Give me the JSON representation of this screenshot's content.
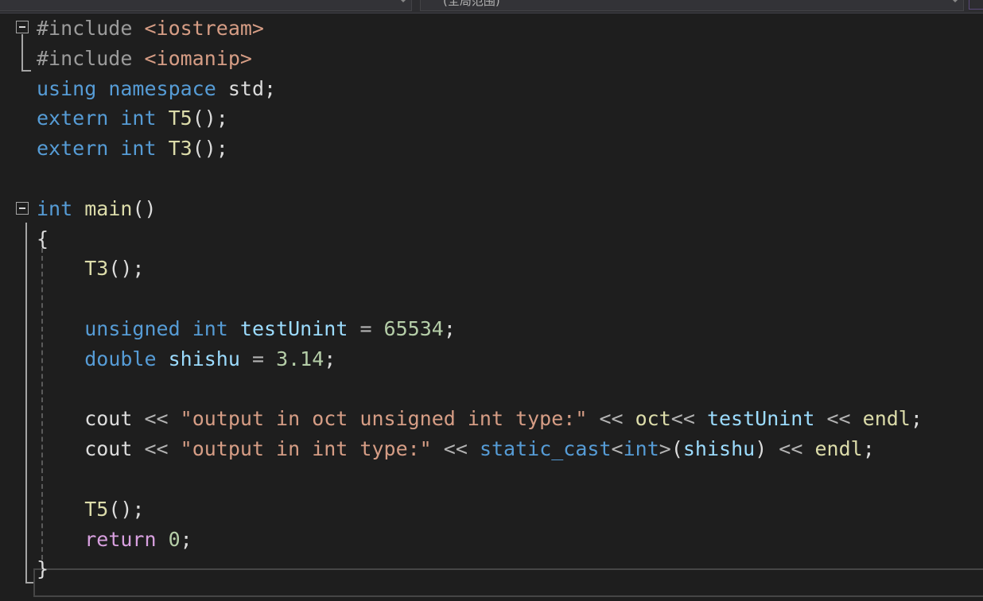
{
  "navbar": {
    "scope_dropdown": "(全局范围)"
  },
  "editor": {
    "lines": [
      {
        "tokens": [
          {
            "c": "inc",
            "t": "#include "
          },
          {
            "c": "hdr",
            "t": "<iostream>"
          }
        ]
      },
      {
        "tokens": [
          {
            "c": "inc",
            "t": "#include "
          },
          {
            "c": "hdr",
            "t": "<iomanip>"
          }
        ]
      },
      {
        "tokens": [
          {
            "c": "kw",
            "t": "using"
          },
          {
            "c": "id",
            "t": " "
          },
          {
            "c": "kw",
            "t": "namespace"
          },
          {
            "c": "id",
            "t": " std;"
          }
        ]
      },
      {
        "tokens": [
          {
            "c": "kw",
            "t": "extern"
          },
          {
            "c": "id",
            "t": " "
          },
          {
            "c": "kw",
            "t": "int"
          },
          {
            "c": "id",
            "t": " "
          },
          {
            "c": "fn",
            "t": "T5"
          },
          {
            "c": "id",
            "t": "();"
          }
        ]
      },
      {
        "tokens": [
          {
            "c": "kw",
            "t": "extern"
          },
          {
            "c": "id",
            "t": " "
          },
          {
            "c": "kw",
            "t": "int"
          },
          {
            "c": "id",
            "t": " "
          },
          {
            "c": "fn",
            "t": "T3"
          },
          {
            "c": "id",
            "t": "();"
          }
        ]
      },
      {
        "tokens": []
      },
      {
        "tokens": [
          {
            "c": "kw",
            "t": "int"
          },
          {
            "c": "id",
            "t": " "
          },
          {
            "c": "fn",
            "t": "main"
          },
          {
            "c": "id",
            "t": "()"
          }
        ]
      },
      {
        "tokens": [
          {
            "c": "id",
            "t": "{"
          }
        ]
      },
      {
        "tokens": [
          {
            "c": "id",
            "t": "    "
          },
          {
            "c": "fn",
            "t": "T3"
          },
          {
            "c": "id",
            "t": "();"
          }
        ]
      },
      {
        "tokens": []
      },
      {
        "tokens": [
          {
            "c": "id",
            "t": "    "
          },
          {
            "c": "kw",
            "t": "unsigned"
          },
          {
            "c": "id",
            "t": " "
          },
          {
            "c": "kw",
            "t": "int"
          },
          {
            "c": "id",
            "t": " "
          },
          {
            "c": "var",
            "t": "testUnint"
          },
          {
            "c": "op",
            "t": " = "
          },
          {
            "c": "num",
            "t": "65534"
          },
          {
            "c": "id",
            "t": ";"
          }
        ]
      },
      {
        "tokens": [
          {
            "c": "id",
            "t": "    "
          },
          {
            "c": "kw",
            "t": "double"
          },
          {
            "c": "id",
            "t": " "
          },
          {
            "c": "var",
            "t": "shishu"
          },
          {
            "c": "op",
            "t": " = "
          },
          {
            "c": "num",
            "t": "3.14"
          },
          {
            "c": "id",
            "t": ";"
          }
        ]
      },
      {
        "tokens": []
      },
      {
        "tokens": [
          {
            "c": "id",
            "t": "    cout "
          },
          {
            "c": "op",
            "t": "<<"
          },
          {
            "c": "id",
            "t": " "
          },
          {
            "c": "str",
            "t": "\"output in oct unsigned int type:\""
          },
          {
            "c": "id",
            "t": " "
          },
          {
            "c": "op",
            "t": "<<"
          },
          {
            "c": "id",
            "t": " "
          },
          {
            "c": "fn",
            "t": "oct"
          },
          {
            "c": "op",
            "t": "<<"
          },
          {
            "c": "id",
            "t": " "
          },
          {
            "c": "var",
            "t": "testUnint"
          },
          {
            "c": "id",
            "t": " "
          },
          {
            "c": "op",
            "t": "<<"
          },
          {
            "c": "id",
            "t": " "
          },
          {
            "c": "fn",
            "t": "endl"
          },
          {
            "c": "id",
            "t": ";"
          }
        ]
      },
      {
        "tokens": [
          {
            "c": "id",
            "t": "    cout "
          },
          {
            "c": "op",
            "t": "<<"
          },
          {
            "c": "id",
            "t": " "
          },
          {
            "c": "str",
            "t": "\"output in int type:\""
          },
          {
            "c": "id",
            "t": " "
          },
          {
            "c": "op",
            "t": "<<"
          },
          {
            "c": "id",
            "t": " "
          },
          {
            "c": "kw",
            "t": "static_cast"
          },
          {
            "c": "op",
            "t": "<"
          },
          {
            "c": "kw",
            "t": "int"
          },
          {
            "c": "op",
            "t": ">"
          },
          {
            "c": "id",
            "t": "("
          },
          {
            "c": "var",
            "t": "shishu"
          },
          {
            "c": "id",
            "t": ") "
          },
          {
            "c": "op",
            "t": "<<"
          },
          {
            "c": "id",
            "t": " "
          },
          {
            "c": "fn",
            "t": "endl"
          },
          {
            "c": "id",
            "t": ";"
          }
        ]
      },
      {
        "tokens": []
      },
      {
        "tokens": [
          {
            "c": "id",
            "t": "    "
          },
          {
            "c": "fn",
            "t": "T5"
          },
          {
            "c": "id",
            "t": "();"
          }
        ]
      },
      {
        "tokens": [
          {
            "c": "id",
            "t": "    "
          },
          {
            "c": "ctl",
            "t": "return"
          },
          {
            "c": "id",
            "t": " "
          },
          {
            "c": "num",
            "t": "0"
          },
          {
            "c": "id",
            "t": ";"
          }
        ]
      },
      {
        "tokens": [
          {
            "c": "id",
            "t": "}"
          }
        ]
      }
    ]
  }
}
